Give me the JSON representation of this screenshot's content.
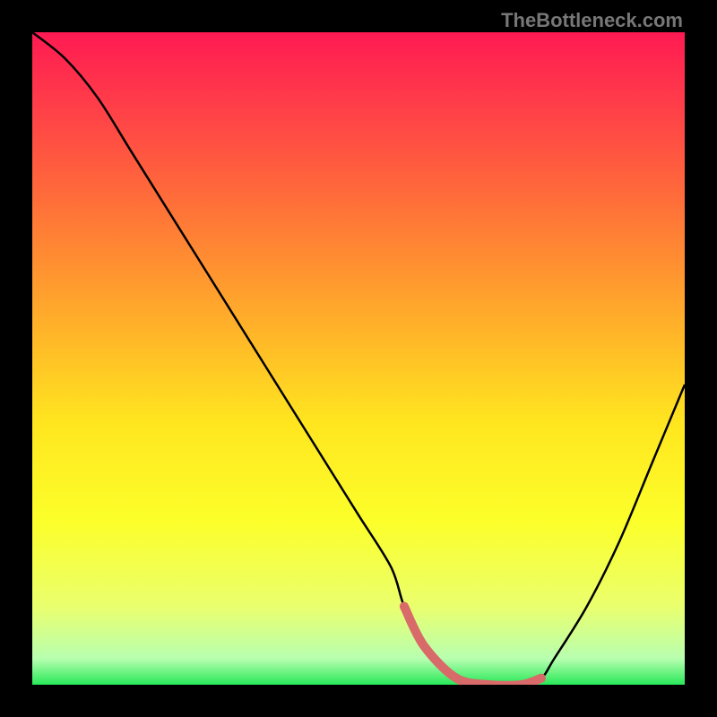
{
  "watermark": "TheBottleneck.com",
  "chart_data": {
    "type": "line",
    "title": "",
    "xlabel": "",
    "ylabel": "",
    "xlim": [
      0,
      100
    ],
    "ylim": [
      0,
      100
    ],
    "series": [
      {
        "name": "bottleneck-curve",
        "x": [
          0,
          5,
          10,
          15,
          20,
          25,
          30,
          35,
          40,
          45,
          50,
          55,
          57,
          60,
          65,
          70,
          75,
          78,
          80,
          85,
          90,
          95,
          100
        ],
        "y": [
          100,
          96,
          90,
          82,
          74,
          66,
          58,
          50,
          42,
          34,
          26,
          18,
          12,
          6,
          1,
          0,
          0,
          1,
          4,
          12,
          22,
          34,
          46
        ]
      }
    ],
    "highlight_segment": {
      "name": "optimal-range",
      "x": [
        57,
        60,
        65,
        70,
        75,
        78
      ],
      "y": [
        12,
        6,
        1,
        0,
        0,
        1
      ]
    },
    "gradient_stops": [
      {
        "offset": 0.0,
        "color": "#ff1a52"
      },
      {
        "offset": 0.1,
        "color": "#ff3a4a"
      },
      {
        "offset": 0.25,
        "color": "#ff6b3a"
      },
      {
        "offset": 0.45,
        "color": "#ffb129"
      },
      {
        "offset": 0.6,
        "color": "#ffe61f"
      },
      {
        "offset": 0.75,
        "color": "#fcff2a"
      },
      {
        "offset": 0.88,
        "color": "#eaff6e"
      },
      {
        "offset": 0.96,
        "color": "#b8ffb0"
      },
      {
        "offset": 1.0,
        "color": "#28e858"
      }
    ],
    "highlight_color": "#d86a6a"
  }
}
